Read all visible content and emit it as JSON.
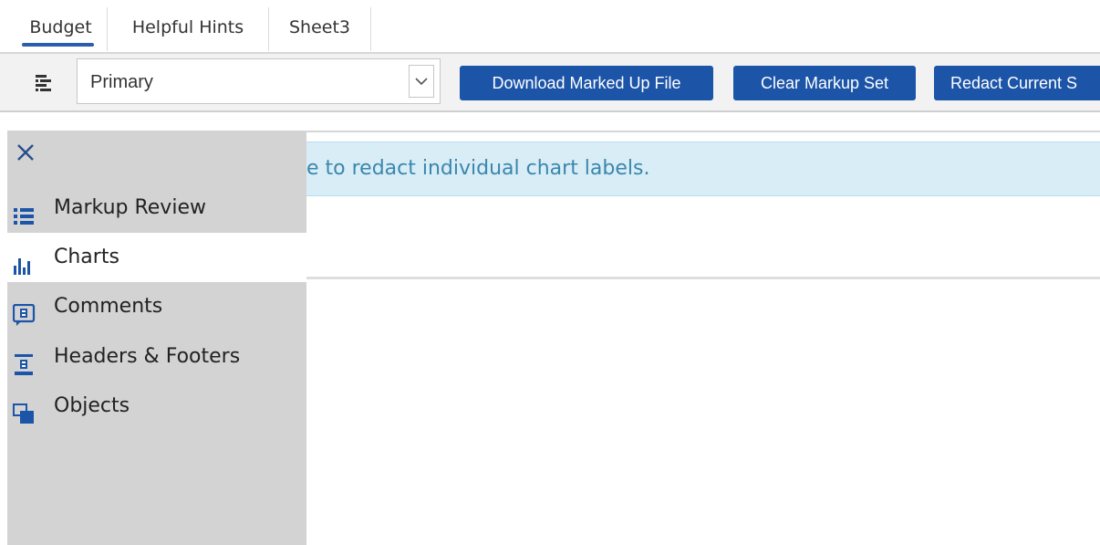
{
  "tabs": [
    {
      "label": "Budget",
      "active": true
    },
    {
      "label": "Helpful Hints",
      "active": false
    },
    {
      "label": "Sheet3",
      "active": false
    }
  ],
  "toolbar": {
    "markup_set_select": {
      "value": "Primary"
    },
    "buttons": {
      "download": "Download Marked Up File",
      "clear": "Clear Markup Set",
      "redact": "Redact Current S"
    }
  },
  "banner": {
    "text": "e to redact individual chart labels."
  },
  "panel": {
    "close_icon": "close-icon",
    "items": [
      {
        "label": "Markup Review",
        "icon": "list-icon",
        "active": false
      },
      {
        "label": "Charts",
        "icon": "bar-chart-icon",
        "active": true
      },
      {
        "label": "Comments",
        "icon": "comment-icon",
        "active": false
      },
      {
        "label": "Headers & Footers",
        "icon": "header-footer-icon",
        "active": false
      },
      {
        "label": "Objects",
        "icon": "objects-icon",
        "active": false
      }
    ]
  },
  "colors": {
    "accent": "#1c54a8",
    "tab_underline": "#2a5cb0",
    "banner_bg": "#d9edf7",
    "banner_text": "#3a87ad",
    "panel_bg": "#d3d3d3"
  }
}
